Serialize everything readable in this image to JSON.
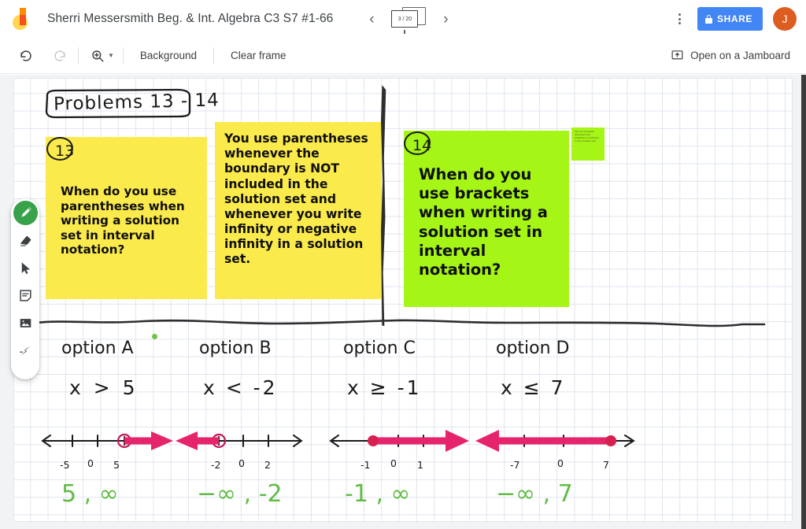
{
  "app": {
    "name": "Google Jamboard",
    "logo_icon": "jamboard-logo"
  },
  "header": {
    "doc_title": "Sherri Messersmith Beg. & Int. Algebra C3 S7 #1-66",
    "prev_frame_icon": "chevron-left-icon",
    "next_frame_icon": "chevron-right-icon",
    "frame_counter": "3 / 20",
    "frame_counter_icon": "frames-icon",
    "more_icon": "kebab-menu-icon",
    "share_label": "SHARE",
    "share_icon": "lock-icon",
    "share_color": "#4285f4",
    "avatar_initial": "J",
    "avatar_color": "#DD5C1F"
  },
  "toolbar": {
    "undo_icon": "undo-icon",
    "redo_icon": "redo-icon",
    "zoom_icon": "zoom-in-icon",
    "zoom_caret_icon": "chevron-down-icon",
    "background_label": "Background",
    "clear_frame_label": "Clear frame",
    "open_jamboard_label": "Open on a Jamboard",
    "open_jamboard_icon": "cast-to-jamboard-icon"
  },
  "tools": [
    {
      "name": "pen",
      "icon": "pen-icon",
      "active": true
    },
    {
      "name": "eraser",
      "icon": "eraser-icon",
      "active": false
    },
    {
      "name": "select",
      "icon": "cursor-icon",
      "active": false
    },
    {
      "name": "sticky-note",
      "icon": "sticky-note-icon",
      "active": false
    },
    {
      "name": "image",
      "icon": "image-icon",
      "active": false
    },
    {
      "name": "laser",
      "icon": "laser-pointer-icon",
      "active": false
    }
  ],
  "canvas": {
    "heading": "Problems 13 - 14",
    "notes": [
      {
        "id": "note-13-question",
        "color": "yellow",
        "hex": "#FBEA4C",
        "number_label": "13",
        "text": "When do you use parentheses when writing a solution set in interval notation?"
      },
      {
        "id": "note-13-answer",
        "color": "yellow",
        "hex": "#FBEA4C",
        "number_label": "",
        "text": "You use parentheses whenever the boundary is NOT included in the solution set and whenever you write infinity or negative infinity in a solution set."
      },
      {
        "id": "note-14-question",
        "color": "green",
        "hex": "#A5F516",
        "number_label": "14",
        "text": "When do you use brackets when writing a solution set in interval notation?"
      },
      {
        "id": "note-14-answer-small",
        "color": "green",
        "hex": "#A5F516",
        "number_label": "",
        "text": ""
      }
    ],
    "options": [
      {
        "title": "option A",
        "inequality": "x > 5",
        "tick_labels": [
          "-5",
          "0",
          "5"
        ],
        "endpoint": "open",
        "direction": "right",
        "answer": "5 , ∞"
      },
      {
        "title": "option B",
        "inequality": "x < -2",
        "tick_labels": [
          "-2",
          "0",
          "2"
        ],
        "endpoint": "open",
        "direction": "left",
        "answer": "−∞ , -2"
      },
      {
        "title": "option C",
        "inequality": "x ≥ -1",
        "tick_labels": [
          "-1",
          "0",
          "1"
        ],
        "endpoint": "closed",
        "direction": "right",
        "answer": "-1 , ∞"
      },
      {
        "title": "option D",
        "inequality": "x ≤ 7",
        "tick_labels": [
          "-7",
          "0",
          "7"
        ],
        "endpoint": "closed",
        "direction": "left",
        "answer": "−∞ , 7"
      }
    ],
    "ink_colors": {
      "black": "#1a1a1a",
      "green": "#62bb46",
      "pink": "#E6246B"
    }
  }
}
